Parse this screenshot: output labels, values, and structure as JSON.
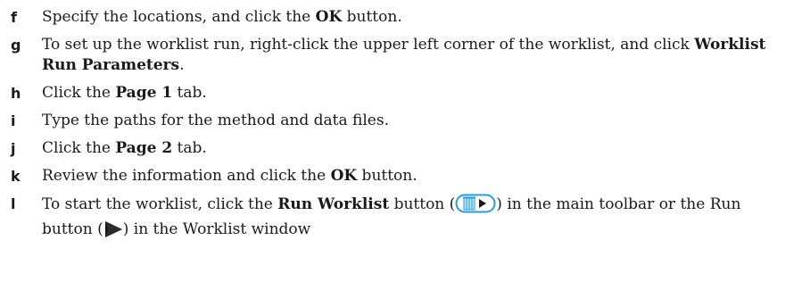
{
  "steps": [
    {
      "letter": "f",
      "text_1": "Specify the locations, and click the ",
      "bold_1": "OK",
      "text_2": " button."
    },
    {
      "letter": "g",
      "text_1": "To set up the worklist run, right-click the upper left corner of the worklist, and click ",
      "bold_1": "Worklist Run Parameters",
      "text_2": "."
    },
    {
      "letter": "h",
      "text_1": "Click the ",
      "bold_1": "Page 1",
      "text_2": " tab."
    },
    {
      "letter": "i",
      "text_1": "Type the paths for the method and data files."
    },
    {
      "letter": "j",
      "text_1": "Click the ",
      "bold_1": "Page 2",
      "text_2": " tab."
    },
    {
      "letter": "k",
      "text_1": "Review the information and click the ",
      "bold_1": "OK",
      "text_2": " button."
    },
    {
      "letter": "l",
      "text_1": "To start the worklist, click the ",
      "bold_1": "Run Worklist",
      "text_2": " button (",
      "text_3": ") in the main toolbar or the Run button (",
      "text_4": ") in the Worklist window"
    }
  ],
  "icons": {
    "run_worklist_icon": "run-worklist-icon",
    "run_icon": "run-triangle-icon"
  },
  "colors": {
    "icon_blue": "#2a9bd7",
    "icon_light": "#b9e3f7"
  }
}
